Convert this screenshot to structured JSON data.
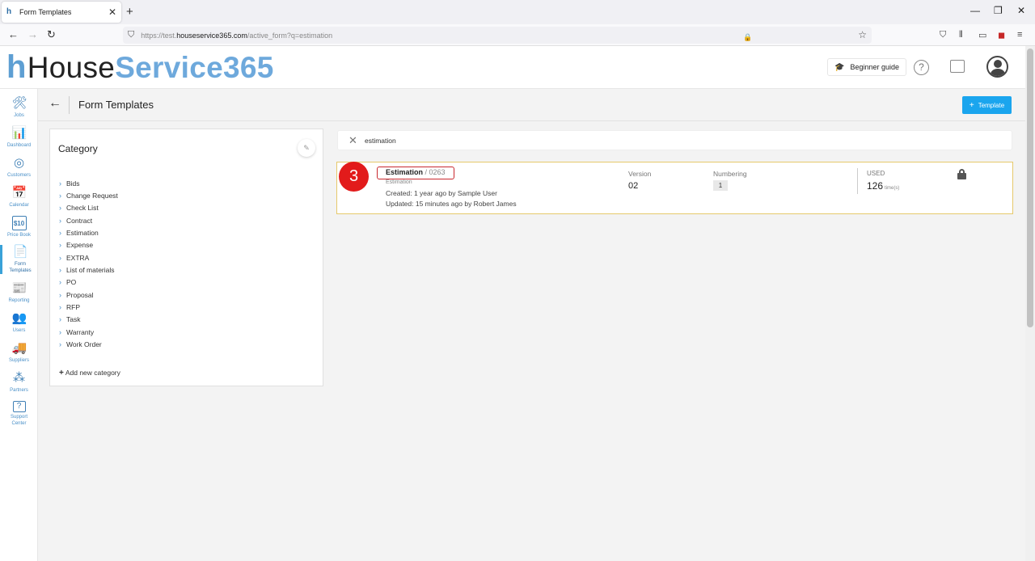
{
  "browser": {
    "tab_title": "Form Templates",
    "tab_close": "✕",
    "new_tab": "+",
    "url_prefix": "https://test.",
    "url_host": "houseservice365.com",
    "url_path": "/active_form?q=estimation",
    "win_minimize": "—",
    "win_restore": "❐",
    "win_close": "✕"
  },
  "header": {
    "logo_house": "House",
    "logo_service": "Service365",
    "beginner_guide": "Beginner guide",
    "help": "?"
  },
  "sidebar": {
    "items": [
      {
        "label": "Jobs",
        "icon": "🛠"
      },
      {
        "label": "Dashboard",
        "icon": "📊"
      },
      {
        "label": "Customers",
        "icon": "◎"
      },
      {
        "label": "Calendar",
        "icon": "📅"
      },
      {
        "label": "Price Book",
        "icon": "$10"
      },
      {
        "label": "Form Templates",
        "icon": "📄"
      },
      {
        "label": "Reporting",
        "icon": "📰"
      },
      {
        "label": "Users",
        "icon": "👥"
      },
      {
        "label": "Suppliers",
        "icon": "🚚"
      },
      {
        "label": "Partners",
        "icon": "⁂"
      },
      {
        "label": "Support Center",
        "icon": "?"
      }
    ]
  },
  "page": {
    "back": "←",
    "title": "Form Templates",
    "add_template": "Template"
  },
  "category": {
    "title": "Category",
    "items": [
      "Bids",
      "Change Request",
      "Check List",
      "Contract",
      "Estimation",
      "Expense",
      "EXTRA",
      "List of materials",
      "PO",
      "Proposal",
      "RFP",
      "Task",
      "Warranty",
      "Work Order"
    ],
    "add_new": "Add new category"
  },
  "search": {
    "query": "estimation"
  },
  "result": {
    "step": "3",
    "name": "Estimation",
    "number": "/ 0263",
    "category": "Estimation",
    "created": "Created: 1 year ago by Sample User",
    "updated": "Updated: 15 minutes ago by Robert James",
    "version_label": "Version",
    "version_value": "02",
    "numbering_label": "Numbering",
    "numbering_value": "1",
    "used_label": "USED",
    "used_value": "126",
    "used_unit": "time(s)"
  },
  "colors": {
    "accent": "#1aa5ee",
    "logo_blue": "#6ea9dc",
    "highlight_border": "#e6c96b",
    "badge_red": "#e21b1b"
  }
}
